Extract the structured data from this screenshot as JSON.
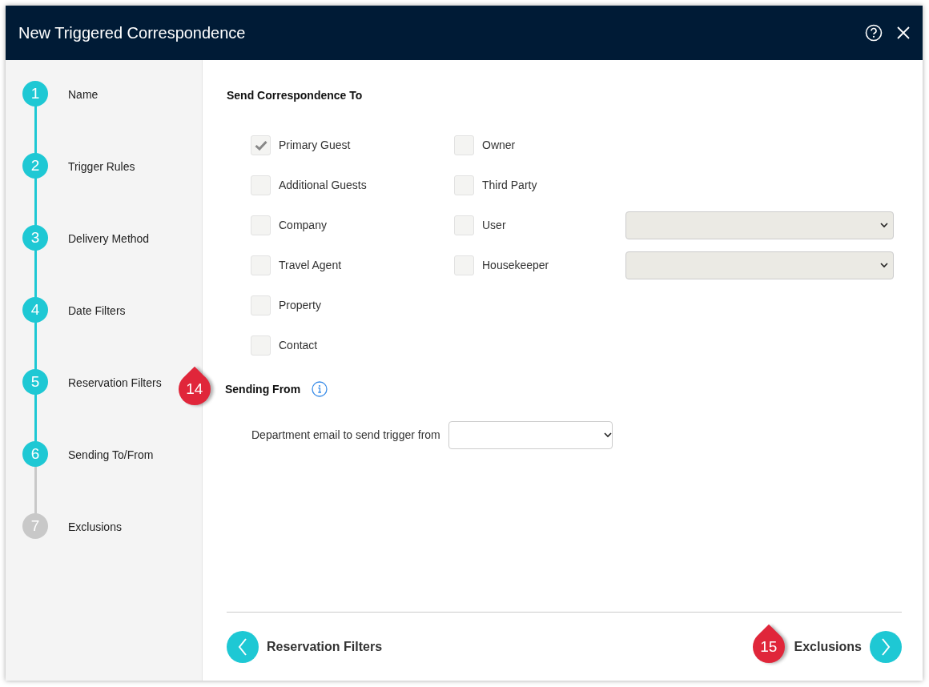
{
  "window": {
    "title": "New Triggered Correspondence"
  },
  "steps": [
    {
      "number": "1",
      "label": "Name",
      "done": true
    },
    {
      "number": "2",
      "label": "Trigger Rules",
      "done": true
    },
    {
      "number": "3",
      "label": "Delivery Method",
      "done": true
    },
    {
      "number": "4",
      "label": "Date Filters",
      "done": true
    },
    {
      "number": "5",
      "label": "Reservation Filters",
      "done": true
    },
    {
      "number": "6",
      "label": "Sending To/From",
      "done": true
    },
    {
      "number": "7",
      "label": "Exclusions",
      "done": false
    }
  ],
  "send_to": {
    "title": "Send Correspondence To",
    "left": [
      {
        "label": "Primary Guest",
        "checked": true
      },
      {
        "label": "Additional Guests",
        "checked": false
      },
      {
        "label": "Company",
        "checked": false
      },
      {
        "label": "Travel Agent",
        "checked": false
      },
      {
        "label": "Property",
        "checked": false
      },
      {
        "label": "Contact",
        "checked": false
      }
    ],
    "right": [
      {
        "label": "Owner",
        "checked": false,
        "has_select": false
      },
      {
        "label": "Third Party",
        "checked": false,
        "has_select": false
      },
      {
        "label": "User",
        "checked": false,
        "has_select": true
      },
      {
        "label": "Housekeeper",
        "checked": false,
        "has_select": true
      }
    ]
  },
  "sending_from": {
    "title": "Sending From",
    "callout": "14",
    "field_label": "Department email to send trigger from"
  },
  "footer": {
    "back_label": "Reservation Filters",
    "next_label": "Exclusions",
    "next_callout": "15"
  }
}
